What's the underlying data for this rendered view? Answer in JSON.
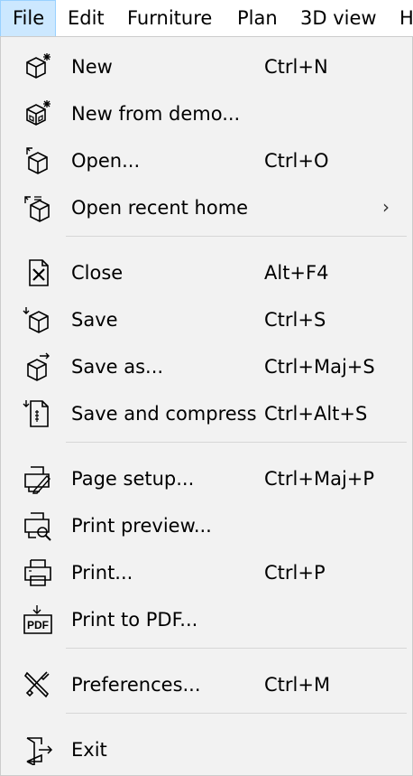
{
  "menubar": {
    "items": [
      "File",
      "Edit",
      "Furniture",
      "Plan",
      "3D view",
      "H"
    ]
  },
  "menu": {
    "items": [
      {
        "label": "New",
        "accel": "Ctrl+N",
        "icon": "new-home-icon"
      },
      {
        "label": "New from demo...",
        "accel": "",
        "icon": "new-from-demo-icon"
      },
      {
        "label": "Open...",
        "accel": "Ctrl+O",
        "icon": "open-icon"
      },
      {
        "label": "Open recent home",
        "accel": "",
        "icon": "open-recent-icon",
        "submenu": "›"
      },
      {
        "label": "Close",
        "accel": "Alt+F4",
        "icon": "close-icon"
      },
      {
        "label": "Save",
        "accel": "Ctrl+S",
        "icon": "save-icon"
      },
      {
        "label": "Save as...",
        "accel": "Ctrl+Maj+S",
        "icon": "save-as-icon"
      },
      {
        "label": "Save and compress",
        "accel": "Ctrl+Alt+S",
        "icon": "save-compress-icon"
      },
      {
        "label": "Page setup...",
        "accel": "Ctrl+Maj+P",
        "icon": "page-setup-icon"
      },
      {
        "label": "Print preview...",
        "accel": "",
        "icon": "print-preview-icon"
      },
      {
        "label": "Print...",
        "accel": "Ctrl+P",
        "icon": "printer-icon"
      },
      {
        "label": "Print to PDF...",
        "accel": "",
        "icon": "pdf-icon",
        "icon_text": "PDF"
      },
      {
        "label": "Preferences...",
        "accel": "Ctrl+M",
        "icon": "preferences-tools-icon"
      },
      {
        "label": "Exit",
        "accel": "",
        "icon": "exit-icon"
      }
    ]
  }
}
